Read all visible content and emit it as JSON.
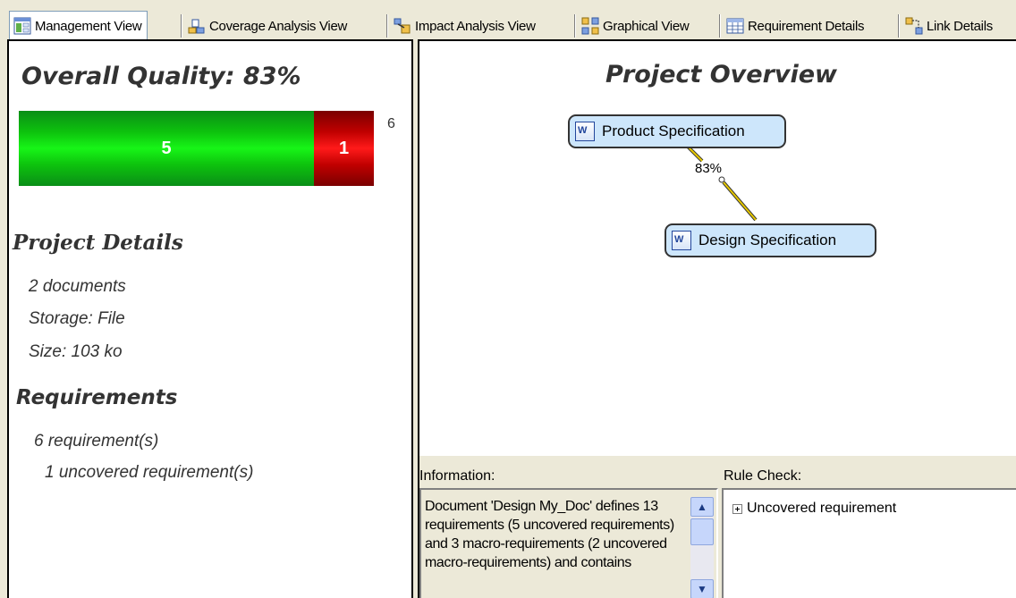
{
  "tabs": [
    {
      "label": "Management View",
      "icon": "management-view-icon"
    },
    {
      "label": "Coverage Analysis View",
      "icon": "coverage-analysis-icon"
    },
    {
      "label": "Impact Analysis View",
      "icon": "impact-analysis-icon"
    },
    {
      "label": "Graphical View",
      "icon": "graphical-view-icon"
    },
    {
      "label": "Requirement Details",
      "icon": "requirement-details-icon"
    },
    {
      "label": "Link Details",
      "icon": "link-details-icon"
    }
  ],
  "left": {
    "quality_title": "Overall Quality: 83%",
    "bar": {
      "covered": "5",
      "uncovered": "1",
      "total": "6",
      "covered_color": "#0dc20d",
      "uncovered_color": "#c00000"
    },
    "project_details_heading": "Project Details",
    "documents": "2 documents",
    "storage": "Storage: File",
    "size": "Size: 103 ko",
    "requirements_heading": "Requirements",
    "requirement_count": "6 requirement(s)",
    "uncovered_count": "1 uncovered requirement(s)"
  },
  "overview": {
    "title": "Project Overview",
    "node_1": "Product Specification",
    "node_2": "Design Specification",
    "link_label": "83%",
    "link_color": "#e6c800",
    "node_fill": "#cde6fb"
  },
  "info": {
    "label": "Information:",
    "text": "Document 'Design My_Doc' defines 13 requirements (5 uncovered requirements) and 3 macro-requirements (2 uncovered macro-requirements) and contains"
  },
  "rules": {
    "label": "Rule Check:",
    "item": "Uncovered requirement"
  }
}
